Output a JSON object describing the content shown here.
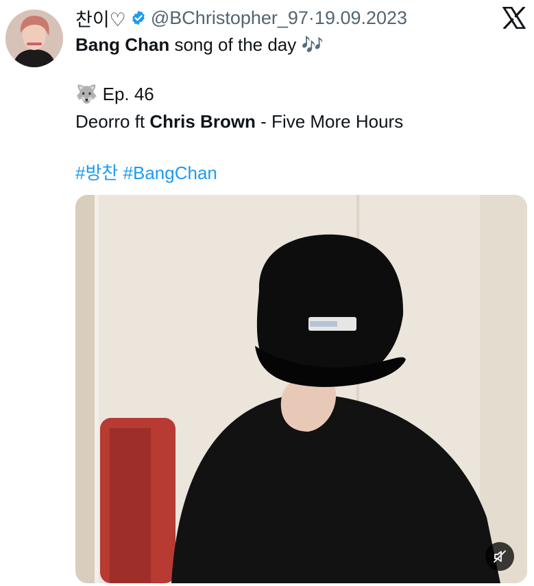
{
  "tweet": {
    "display_name": "찬이♡",
    "handle": "@BChristopher_97",
    "separator": " · ",
    "date": "19.09.2023",
    "line1_bold": "Bang Chan",
    "line1_rest": " song of the day ",
    "line1_emoji": "🎶",
    "episode_emoji": "🐺",
    "episode": " Ep. 46",
    "song_artist": "Deorro ft ",
    "song_featured": "Chris Brown",
    "song_title": " - Five More Hours",
    "hashtags": [
      "#방찬",
      "#BangChan"
    ]
  },
  "icons": {
    "verified": "verified-badge-icon",
    "platform": "x-logo-icon",
    "mute": "mute-speaker-icon"
  },
  "colors": {
    "link": "#1d9bf0",
    "secondary_text": "#536471",
    "primary_text": "#0f1419"
  }
}
